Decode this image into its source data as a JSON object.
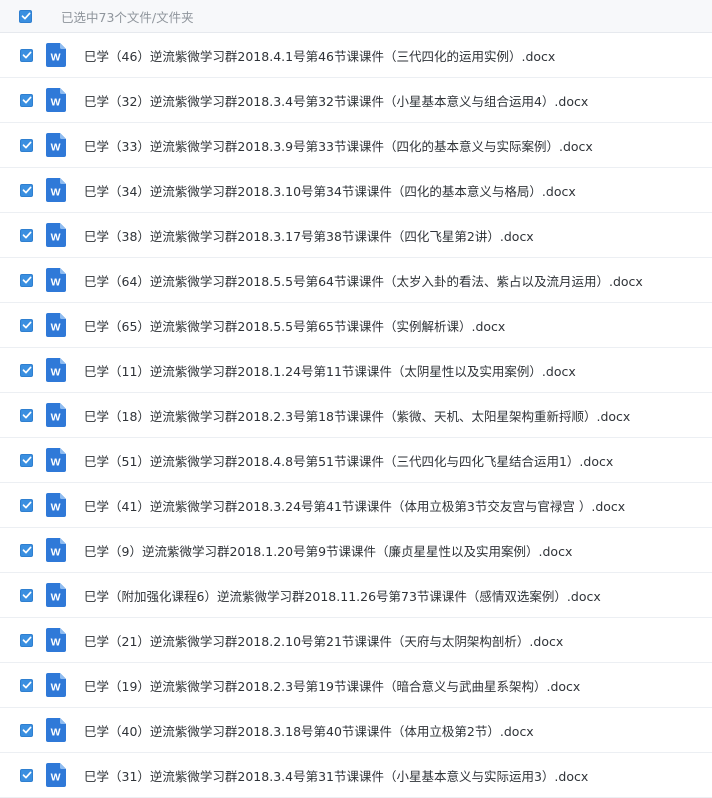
{
  "header": {
    "selection_text": "已选中73个文件/文件夹",
    "checked": true
  },
  "colors": {
    "checkbox": "#3a8fe0",
    "word_icon": "#2f79d8",
    "header_bg": "#f7f8fa",
    "text": "#2f3338"
  },
  "icons": {
    "checkbox": "check-icon",
    "file": "word-doc-icon"
  },
  "files": [
    {
      "name": "巳学（46）逆流紫微学习群2018.4.1号第46节课课件（三代四化的运用实例）.docx",
      "checked": true
    },
    {
      "name": "巳学（32）逆流紫微学习群2018.3.4号第32节课课件（小星基本意义与组合运用4）.docx",
      "checked": true
    },
    {
      "name": "巳学（33）逆流紫微学习群2018.3.9号第33节课课件（四化的基本意义与实际案例）.docx",
      "checked": true
    },
    {
      "name": "巳学（34）逆流紫微学习群2018.3.10号第34节课课件（四化的基本意义与格局）.docx",
      "checked": true
    },
    {
      "name": "巳学（38）逆流紫微学习群2018.3.17号第38节课课件（四化飞星第2讲）.docx",
      "checked": true
    },
    {
      "name": "巳学（64）逆流紫微学习群2018.5.5号第64节课课件（太岁入卦的看法、紫占以及流月运用）.docx",
      "checked": true
    },
    {
      "name": "巳学（65）逆流紫微学习群2018.5.5号第65节课课件（实例解析课）.docx",
      "checked": true
    },
    {
      "name": "巳学（11）逆流紫微学习群2018.1.24号第11节课课件（太阴星性以及实用案例）.docx",
      "checked": true
    },
    {
      "name": "巳学（18）逆流紫微学习群2018.2.3号第18节课课件（紫微、天机、太阳星架构重新捋顺）.docx",
      "checked": true
    },
    {
      "name": "巳学（51）逆流紫微学习群2018.4.8号第51节课课件（三代四化与四化飞星结合运用1）.docx",
      "checked": true
    },
    {
      "name": "巳学（41）逆流紫微学习群2018.3.24号第41节课课件（体用立极第3节交友宫与官禄宫 ）.docx",
      "checked": true
    },
    {
      "name": "巳学（9）逆流紫微学习群2018.1.20号第9节课课件（廉贞星星性以及实用案例）.docx",
      "checked": true
    },
    {
      "name": "巳学（附加强化课程6）逆流紫微学习群2018.11.26号第73节课课件（感情双选案例）.docx",
      "checked": true
    },
    {
      "name": "巳学（21）逆流紫微学习群2018.2.10号第21节课课件（天府与太阴架构剖析）.docx",
      "checked": true
    },
    {
      "name": "巳学（19）逆流紫微学习群2018.2.3号第19节课课件（暗合意义与武曲星系架构）.docx",
      "checked": true
    },
    {
      "name": "巳学（40）逆流紫微学习群2018.3.18号第40节课课件（体用立极第2节）.docx",
      "checked": true
    },
    {
      "name": "巳学（31）逆流紫微学习群2018.3.4号第31节课课件（小星基本意义与实际运用3）.docx",
      "checked": true
    }
  ]
}
